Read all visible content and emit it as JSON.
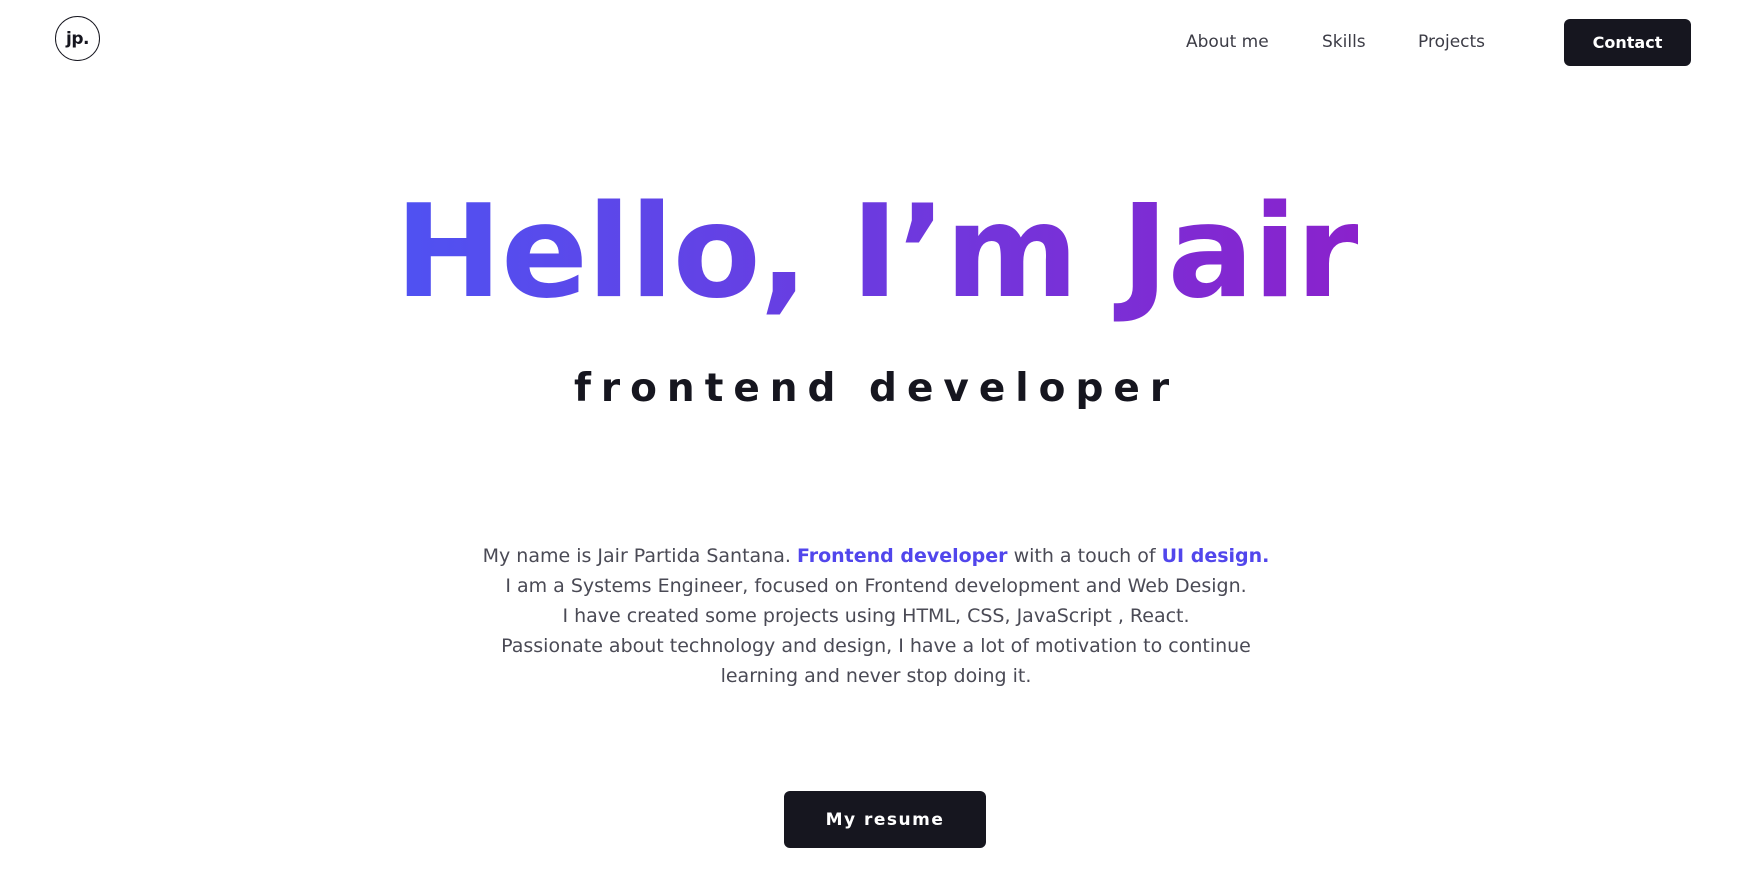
{
  "header": {
    "logo_text": "jp.",
    "nav": {
      "about": "About me",
      "skills": "Skills",
      "projects": "Projects"
    },
    "contact_label": "Contact"
  },
  "hero": {
    "title": "Hello, I’m Jair",
    "subtitle": "frontend developer",
    "gradient_colors": [
      "#4f52f2",
      "#8a22cc"
    ]
  },
  "description": {
    "line1_prefix": "My name is Jair Partida Santana. ",
    "line1_highlight1": "Frontend developer",
    "line1_middle": " with a touch of ",
    "line1_highlight2": "UI design.",
    "line2": "I am a Systems Engineer, focused on Frontend development and Web Design.",
    "line3": "I have created some projects using HTML, CSS, JavaScript , React.",
    "line4": "Passionate about technology and design, I have a lot of motivation to continue",
    "line5": "learning and never stop doing it.",
    "highlight_color": "#5146ec"
  },
  "resume_label": "My resume"
}
